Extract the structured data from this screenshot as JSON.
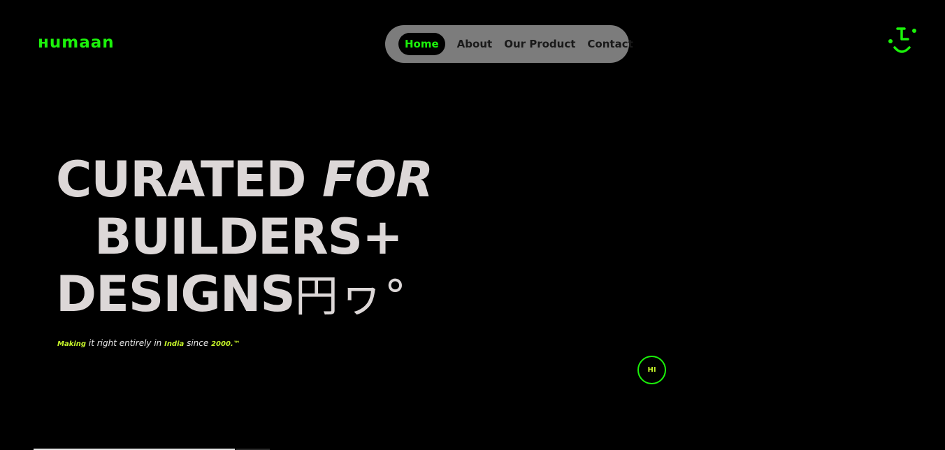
{
  "brand": {
    "logo_text": "ʜumaan",
    "accent_color": "#1bf20a",
    "highlight_color": "#c6f52a",
    "smiley_icon": "smiley-face-icon"
  },
  "nav": {
    "items": [
      {
        "label": "Home",
        "active": true
      },
      {
        "label": "About",
        "active": false
      },
      {
        "label": "Our Product",
        "active": false
      },
      {
        "label": "Contact",
        "active": false
      }
    ]
  },
  "hero": {
    "line1_a": "CURATED ",
    "line1_b": "FOR",
    "line2": "BUILDERS+",
    "line3": "DESIGNS",
    "line3_glyphs": "円ヮ°"
  },
  "tagline": {
    "w1": "Making",
    "w2": " it right entirely in ",
    "w3": "India",
    "w4": " since ",
    "w5": "2000.™"
  },
  "badge": {
    "label": "HI"
  }
}
